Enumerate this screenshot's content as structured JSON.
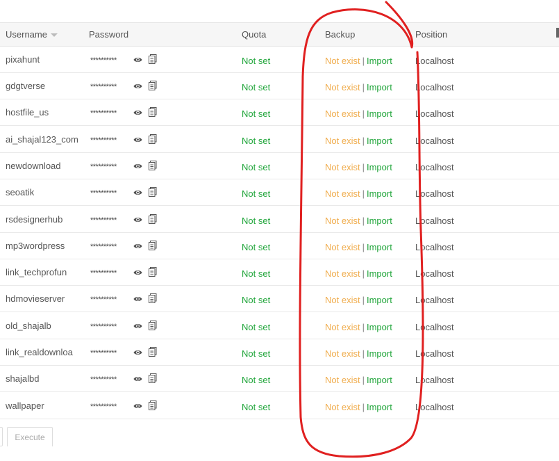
{
  "header": {
    "username": "Username",
    "password": "Password",
    "quota": "Quota",
    "backup": "Backup",
    "position": "Position"
  },
  "rows": [
    {
      "username": "pixahunt",
      "password": "**********",
      "quota": "Not set",
      "backup_status": "Not exist",
      "separator": "|",
      "backup_action": "Import",
      "position": "Localhost"
    },
    {
      "username": "gdgtverse",
      "password": "**********",
      "quota": "Not set",
      "backup_status": "Not exist",
      "separator": "|",
      "backup_action": "Import",
      "position": "Localhost"
    },
    {
      "username": "hostfile_us",
      "password": "**********",
      "quota": "Not set",
      "backup_status": "Not exist",
      "separator": "|",
      "backup_action": "Import",
      "position": "Localhost"
    },
    {
      "username": "ai_shajal123_com",
      "password": "**********",
      "quota": "Not set",
      "backup_status": "Not exist",
      "separator": "|",
      "backup_action": "Import",
      "position": "Localhost"
    },
    {
      "username": "newdownload",
      "password": "**********",
      "quota": "Not set",
      "backup_status": "Not exist",
      "separator": "|",
      "backup_action": "Import",
      "position": "Localhost"
    },
    {
      "username": "seoatik",
      "password": "**********",
      "quota": "Not set",
      "backup_status": "Not exist",
      "separator": "|",
      "backup_action": "Import",
      "position": "Localhost"
    },
    {
      "username": "rsdesignerhub",
      "password": "**********",
      "quota": "Not set",
      "backup_status": "Not exist",
      "separator": "|",
      "backup_action": "Import",
      "position": "Localhost"
    },
    {
      "username": "mp3wordpress",
      "password": "**********",
      "quota": "Not set",
      "backup_status": "Not exist",
      "separator": "|",
      "backup_action": "Import",
      "position": "Localhost"
    },
    {
      "username": "link_techprofun",
      "password": "**********",
      "quota": "Not set",
      "backup_status": "Not exist",
      "separator": "|",
      "backup_action": "Import",
      "position": "Localhost"
    },
    {
      "username": "hdmovieserver",
      "password": "**********",
      "quota": "Not set",
      "backup_status": "Not exist",
      "separator": "|",
      "backup_action": "Import",
      "position": "Localhost"
    },
    {
      "username": "old_shajalb",
      "password": "**********",
      "quota": "Not set",
      "backup_status": "Not exist",
      "separator": "|",
      "backup_action": "Import",
      "position": "Localhost"
    },
    {
      "username": "link_realdownloa",
      "password": "**********",
      "quota": "Not set",
      "backup_status": "Not exist",
      "separator": "|",
      "backup_action": "Import",
      "position": "Localhost"
    },
    {
      "username": "shajalbd",
      "password": "**********",
      "quota": "Not set",
      "backup_status": "Not exist",
      "separator": "|",
      "backup_action": "Import",
      "position": "Localhost"
    },
    {
      "username": "wallpaper",
      "password": "**********",
      "quota": "Not set",
      "backup_status": "Not exist",
      "separator": "|",
      "backup_action": "Import",
      "position": "Localhost"
    }
  ],
  "footer": {
    "execute_label": "Execute"
  },
  "icons": {
    "show_password": "eye-icon",
    "copy_password": "copy-icon"
  },
  "colors": {
    "quota_text": "#20a53a",
    "not_exist_text": "#f0ad4e",
    "import_link": "#20a53a",
    "annotation_stroke": "#e02020"
  }
}
